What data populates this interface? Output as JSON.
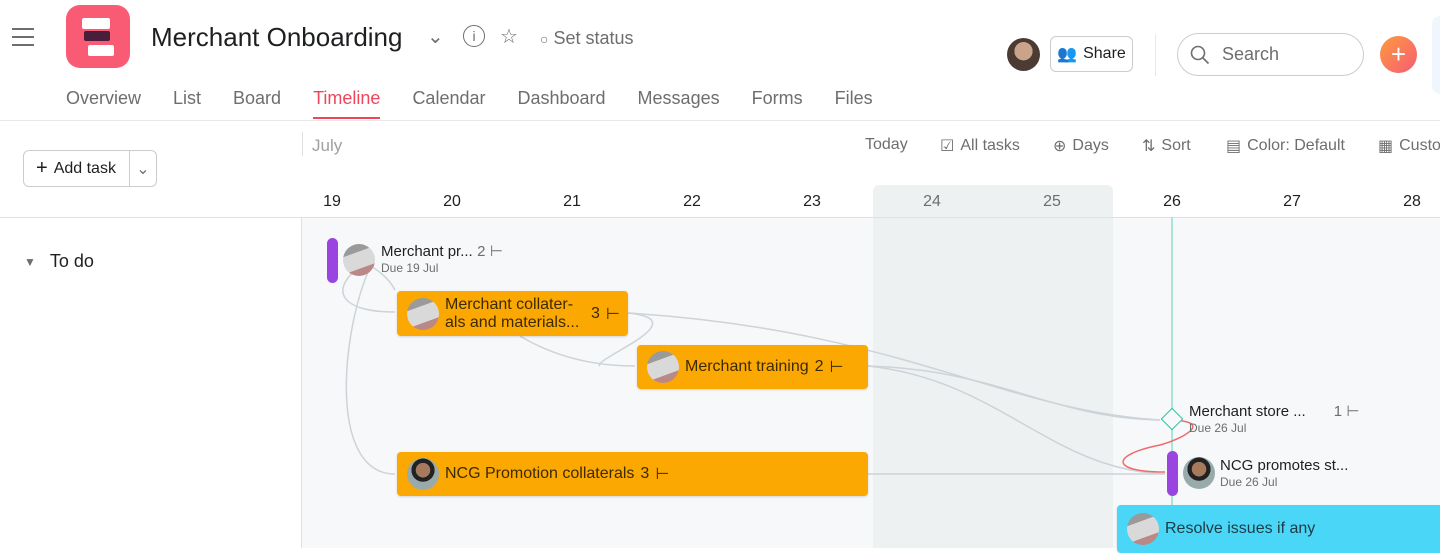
{
  "header": {
    "project_title": "Merchant Onboarding",
    "set_status": "Set status",
    "share": "Share",
    "search_placeholder": "Search"
  },
  "tabs": [
    {
      "label": "Overview"
    },
    {
      "label": "List"
    },
    {
      "label": "Board"
    },
    {
      "label": "Timeline",
      "active": true
    },
    {
      "label": "Calendar"
    },
    {
      "label": "Dashboard"
    },
    {
      "label": "Messages"
    },
    {
      "label": "Forms"
    },
    {
      "label": "Files"
    }
  ],
  "toolbar": {
    "add_task": "Add task",
    "month": "July",
    "today": "Today",
    "all_tasks": "All tasks",
    "days": "Days",
    "sort": "Sort",
    "color": "Color: Default",
    "customize": "Custo"
  },
  "dates": [
    "19",
    "20",
    "21",
    "22",
    "23",
    "24",
    "25",
    "26",
    "27",
    "28"
  ],
  "section": {
    "label": "To do"
  },
  "tasks": [
    {
      "name": "Merchant pr...",
      "subtasks": "2",
      "due": "Due 19 Jul",
      "type": "milestone-bar"
    },
    {
      "name": "Merchant collater-",
      "name2": "als and materials...",
      "subtasks": "3",
      "color": "#fba802"
    },
    {
      "name": "Merchant training",
      "subtasks": "2",
      "color": "#fba802"
    },
    {
      "name": "Merchant store ...",
      "subtasks": "1",
      "due": "Due 26 Jul",
      "type": "milestone"
    },
    {
      "name": "NCG Promotion collaterals",
      "subtasks": "3",
      "color": "#fba802"
    },
    {
      "name": "NCG promotes st...",
      "due": "Due 26 Jul",
      "type": "milestone-bar"
    },
    {
      "name": "Resolve issues if any",
      "color": "#4ad7f7"
    }
  ],
  "colors": {
    "accent": "#f0455a",
    "milestone": "#9b45e0",
    "today_line": "#a8e6d8"
  }
}
